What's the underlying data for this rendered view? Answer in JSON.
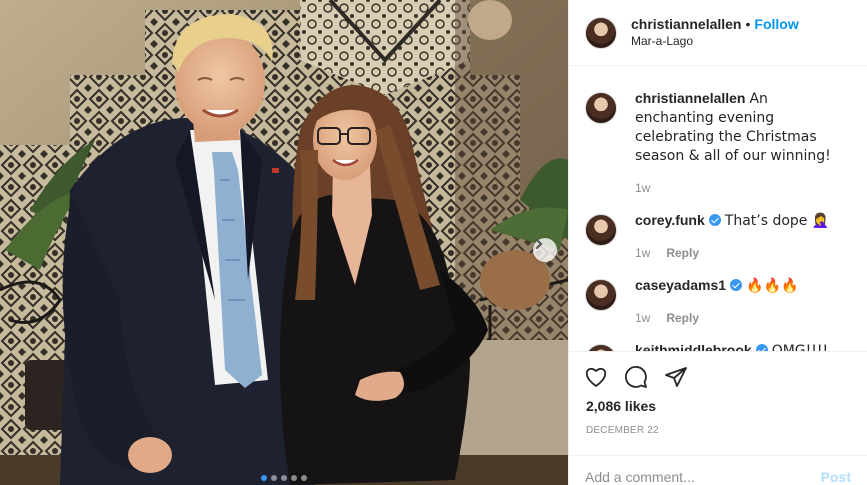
{
  "post": {
    "author": "christiannelallen",
    "follow_label": "Follow",
    "location": "Mar-a-Lago",
    "bullet": "•"
  },
  "comments": [
    {
      "user": "christiannelallen",
      "verified": false,
      "text": "An enchanting evening celebrating the Christmas season & all of our winning!",
      "time": "1w",
      "reply": ""
    },
    {
      "user": "corey.funk",
      "verified": true,
      "text": "That’s dope 🤦‍♀️",
      "time": "1w",
      "reply": "Reply"
    },
    {
      "user": "caseyadams1",
      "verified": true,
      "text": "🔥🔥🔥",
      "time": "1w",
      "reply": "Reply"
    },
    {
      "user": "keithmiddlebrook",
      "verified": true,
      "text": "OMG!!!!",
      "time": "",
      "reply": ""
    }
  ],
  "actions": {
    "icons": [
      "heart-icon",
      "comment-icon",
      "share-icon"
    ],
    "likes": "2,086 likes",
    "date": "DECEMBER 22"
  },
  "add_comment": {
    "placeholder": "Add a comment...",
    "post_label": "Post"
  },
  "photo": {
    "carousel_slides": 5,
    "active_slide": 1,
    "colors": {
      "accent": "#0095f6",
      "wall_tile": "#b9a98b",
      "tile_pattern": "#2e2a24"
    }
  }
}
